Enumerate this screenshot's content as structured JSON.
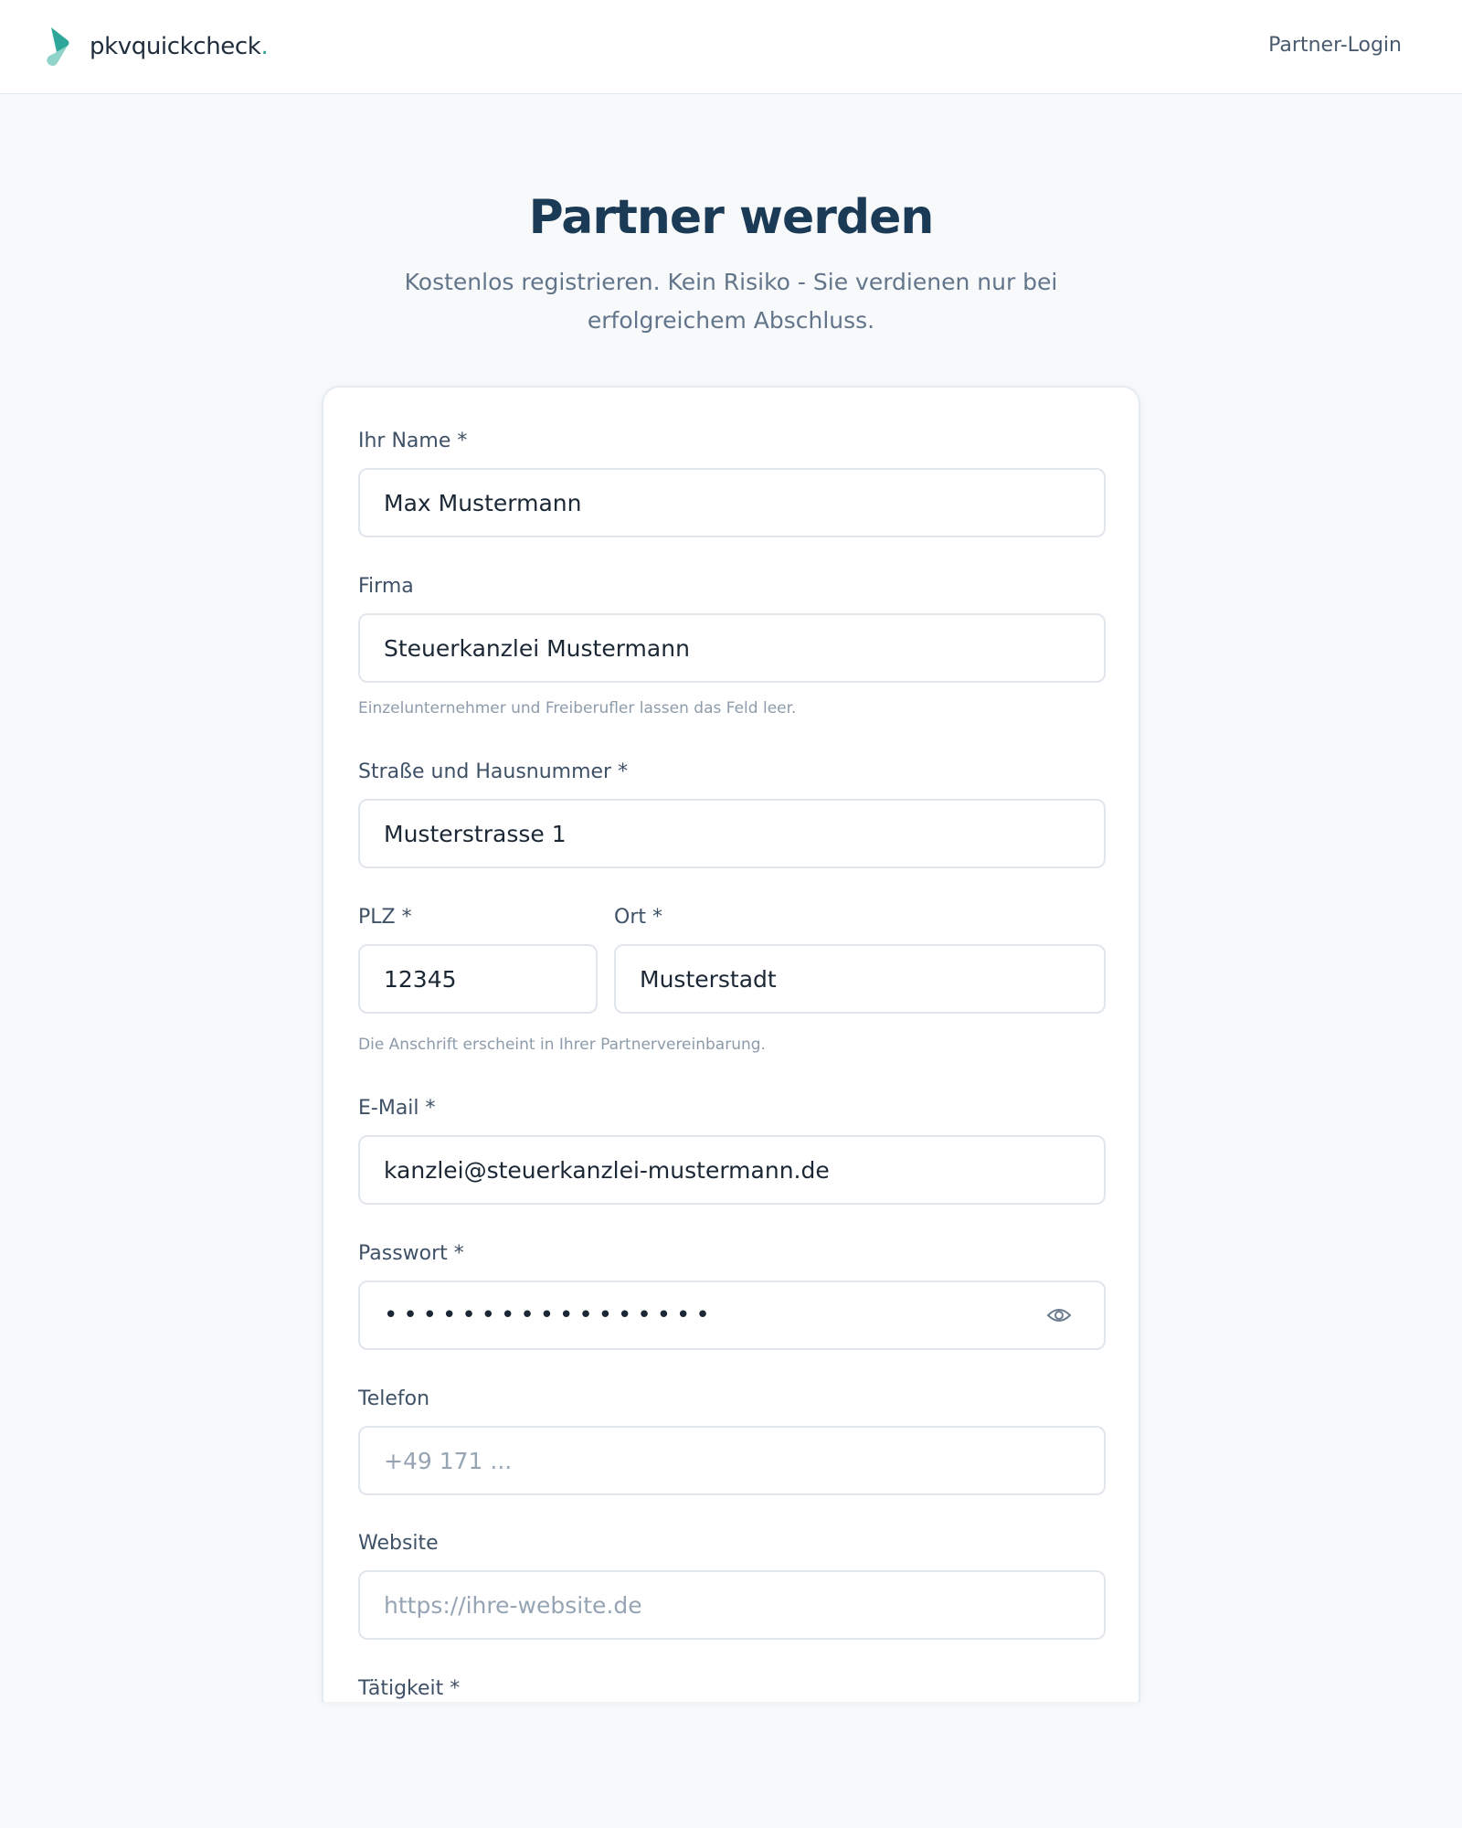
{
  "header": {
    "brand": "pkvquickcheck",
    "brand_dot": ".",
    "login_label": "Partner-Login"
  },
  "hero": {
    "title": "Partner werden",
    "subtitle": "Kostenlos registrieren. Kein Risiko - Sie verdienen nur bei erfolgreichem Abschluss."
  },
  "form": {
    "name": {
      "label": "Ihr Name *",
      "value": "Max Mustermann"
    },
    "firma": {
      "label": "Firma",
      "value": "Steuerkanzlei Mustermann",
      "hint": "Einzelunternehmer und Freiberufler lassen das Feld leer."
    },
    "strasse": {
      "label": "Straße und Hausnummer *",
      "value": "Musterstrasse 1"
    },
    "plz": {
      "label": "PLZ *",
      "value": "12345"
    },
    "ort": {
      "label": "Ort *",
      "value": "Musterstadt"
    },
    "address_hint": "Die Anschrift erscheint in Ihrer Partnervereinbarung.",
    "email": {
      "label": "E-Mail *",
      "value": "kanzlei@steuerkanzlei-mustermann.de"
    },
    "passwort": {
      "label": "Passwort *",
      "masked_value": "•••••••••••••••••",
      "toggle_icon": "eye-icon"
    },
    "telefon": {
      "label": "Telefon",
      "value": "",
      "placeholder": "+49 171 ..."
    },
    "website": {
      "label": "Website",
      "value": "",
      "placeholder": "https://ihre-website.de"
    },
    "taetigkeit": {
      "label": "Tätigkeit *"
    }
  },
  "colors": {
    "brand_teal": "#2fa69a",
    "brand_teal_light": "#8fd3c9",
    "heading": "#1b3a56",
    "page_bg": "#f7f9fb"
  }
}
